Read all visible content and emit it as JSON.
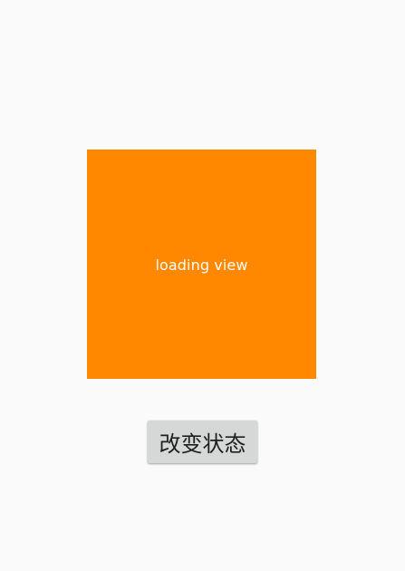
{
  "colors": {
    "background": "#fafafa",
    "loading_view": "#ff8800",
    "loading_text": "#ffffff",
    "button_background": "#d6d7d7",
    "button_text": "#1f1f1f"
  },
  "loading_view": {
    "label": "loading view"
  },
  "actions": {
    "change_state_label": "改变状态"
  }
}
